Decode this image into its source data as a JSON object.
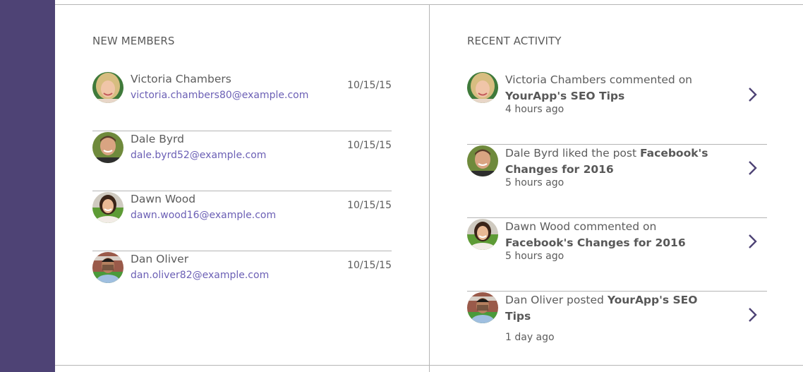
{
  "colors": {
    "sidebar": "#4e4375",
    "link": "#6b5fb5",
    "chevron": "#4e4375",
    "divider": "#b5b5b5"
  },
  "new_members": {
    "title": "NEW MEMBERS",
    "items": [
      {
        "name": "Victoria Chambers",
        "email": "victoria.chambers80@example.com",
        "date": "10/15/15",
        "avatar": "avatar-victoria"
      },
      {
        "name": "Dale Byrd",
        "email": "dale.byrd52@example.com",
        "date": "10/15/15",
        "avatar": "avatar-dale"
      },
      {
        "name": "Dawn Wood",
        "email": "dawn.wood16@example.com",
        "date": "10/15/15",
        "avatar": "avatar-dawn"
      },
      {
        "name": "Dan Oliver",
        "email": "dan.oliver82@example.com",
        "date": "10/15/15",
        "avatar": "avatar-dan"
      }
    ]
  },
  "recent_activity": {
    "title": "RECENT ACTIVITY",
    "items": [
      {
        "actor": "Victoria Chambers",
        "action": " commented on ",
        "target": "YourApp's SEO Tips",
        "time": "4 hours ago",
        "chevron": "chevron-right-icon"
      },
      {
        "actor": "Dale Byrd",
        "action": " liked the post ",
        "target": "Facebook's Changes for 2016",
        "time": "5 hours ago",
        "chevron": "chevron-right-icon"
      },
      {
        "actor": "Dawn Wood",
        "action": " commented on ",
        "target": "Facebook's Changes for 2016",
        "time": "5 hours ago",
        "chevron": "chevron-right-icon"
      },
      {
        "actor": "Dan Oliver",
        "action": " posted ",
        "target": "YourApp's SEO Tips",
        "time": "1 day ago",
        "chevron": "chevron-right-icon"
      }
    ]
  }
}
